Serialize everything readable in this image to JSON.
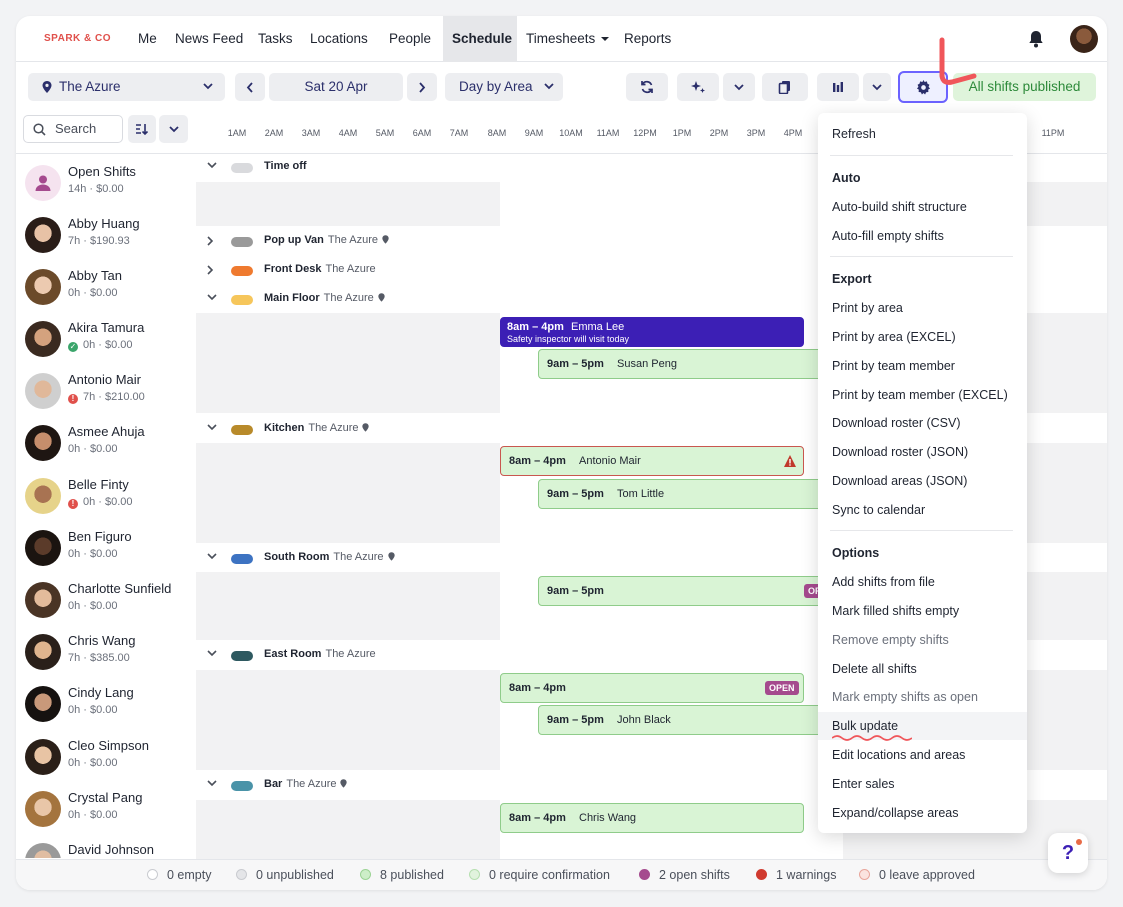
{
  "nav": {
    "brand": "SPARK & CO",
    "items": [
      "Me",
      "News Feed",
      "Tasks",
      "Locations",
      "People",
      "Schedule",
      "Timesheets",
      "Reports"
    ],
    "active": "Schedule"
  },
  "toolbar": {
    "location": "The Azure",
    "date": "Sat 20 Apr",
    "view": "Day by Area",
    "published": "All shifts published"
  },
  "search": {
    "label": "Search"
  },
  "hours": [
    "1AM",
    "2AM",
    "3AM",
    "4AM",
    "5AM",
    "6AM",
    "7AM",
    "8AM",
    "9AM",
    "10AM",
    "11AM",
    "12PM",
    "1PM",
    "2PM",
    "3PM",
    "4PM",
    "11PM"
  ],
  "people": [
    {
      "name": "Open Shifts",
      "meta": "14h · $0.00",
      "status": ""
    },
    {
      "name": "Abby Huang",
      "meta": "7h · $190.93",
      "status": ""
    },
    {
      "name": "Abby Tan",
      "meta": "0h · $0.00",
      "status": ""
    },
    {
      "name": "Akira Tamura",
      "meta": "0h · $0.00",
      "status": "ok"
    },
    {
      "name": "Antonio Mair",
      "meta": "7h · $210.00",
      "status": "warn"
    },
    {
      "name": "Asmee Ahuja",
      "meta": "0h · $0.00",
      "status": ""
    },
    {
      "name": "Belle Finty",
      "meta": "0h · $0.00",
      "status": "warn"
    },
    {
      "name": "Ben Figuro",
      "meta": "0h · $0.00",
      "status": ""
    },
    {
      "name": "Charlotte Sunfield",
      "meta": "0h · $0.00",
      "status": ""
    },
    {
      "name": "Chris Wang",
      "meta": "7h · $385.00",
      "status": ""
    },
    {
      "name": "Cindy Lang",
      "meta": "0h · $0.00",
      "status": ""
    },
    {
      "name": "Cleo Simpson",
      "meta": "0h · $0.00",
      "status": ""
    },
    {
      "name": "Crystal Pang",
      "meta": "0h · $0.00",
      "status": ""
    },
    {
      "name": "David Johnson",
      "meta": "",
      "status": ""
    }
  ],
  "areas": [
    {
      "title": "Time off",
      "loc": "",
      "color": "#d9dadd",
      "pin": false,
      "expanded": true
    },
    {
      "title": "Pop up Van",
      "loc": "The Azure",
      "color": "#9a9a9a",
      "pin": true,
      "expanded": false
    },
    {
      "title": "Front Desk",
      "loc": "The Azure",
      "color": "#ef7a2f",
      "pin": false,
      "expanded": false
    },
    {
      "title": "Main Floor",
      "loc": "The Azure",
      "color": "#f6c65b",
      "pin": true,
      "expanded": true
    },
    {
      "title": "Kitchen",
      "loc": "The Azure",
      "color": "#b88a2a",
      "pin": true,
      "expanded": true
    },
    {
      "title": "South Room",
      "loc": "The Azure",
      "color": "#3d73c2",
      "pin": true,
      "expanded": true
    },
    {
      "title": "East Room",
      "loc": "The Azure",
      "color": "#2e5960",
      "pin": false,
      "expanded": true
    },
    {
      "title": "Bar",
      "loc": "The Azure",
      "color": "#4a93a8",
      "pin": true,
      "expanded": true
    }
  ],
  "shifts": {
    "main_floor_1": {
      "time": "8am – 4pm",
      "who": "Emma Lee",
      "note": "Safety inspector will visit today"
    },
    "main_floor_2": {
      "time": "9am – 5pm",
      "who": "Susan Peng"
    },
    "kitchen_1": {
      "time": "8am – 4pm",
      "who": "Antonio Mair"
    },
    "kitchen_2": {
      "time": "9am – 5pm",
      "who": "Tom Little"
    },
    "south_1": {
      "time": "9am – 5pm",
      "who": "",
      "badge": "OP"
    },
    "east_1": {
      "time": "8am – 4pm",
      "who": "",
      "badge": "OPEN"
    },
    "east_2": {
      "time": "9am – 5pm",
      "who": "John Black"
    },
    "bar_1": {
      "time": "8am – 4pm",
      "who": "Chris Wang"
    }
  },
  "menu": {
    "refresh": "Refresh",
    "auto_head": "Auto",
    "auto_build": "Auto-build shift structure",
    "auto_fill": "Auto-fill empty shifts",
    "export_head": "Export",
    "print_area": "Print by area",
    "print_area_excel": "Print by area (EXCEL)",
    "print_member": "Print by team member",
    "print_member_excel": "Print by team member (EXCEL)",
    "download_csv": "Download roster (CSV)",
    "download_json": "Download roster (JSON)",
    "download_areas": "Download areas (JSON)",
    "sync": "Sync to calendar",
    "options_head": "Options",
    "add_from_file": "Add shifts from file",
    "mark_filled_empty": "Mark filled shifts empty",
    "remove_empty": "Remove empty shifts",
    "delete_all": "Delete all shifts",
    "mark_empty_open": "Mark empty shifts as open",
    "bulk_update": "Bulk update",
    "edit_locations": "Edit locations and areas",
    "enter_sales": "Enter sales",
    "expand_collapse": "Expand/collapse areas"
  },
  "legend": [
    {
      "label": "0 empty",
      "color": "#ffffff"
    },
    {
      "label": "0 unpublished",
      "color": "#e4e5e8"
    },
    {
      "label": "8 published",
      "color": "#cdeec8"
    },
    {
      "label": "0 require confirmation",
      "color": "#e1f3dd"
    },
    {
      "label": "2 open shifts",
      "color": "#a54a8e"
    },
    {
      "label": "1 warnings",
      "color": "#d03a2f"
    },
    {
      "label": "0 leave approved",
      "color": "#fbe3df"
    }
  ],
  "colors": {
    "accent": "#3c1fb5",
    "brand": "#e0504b",
    "published_bg": "#dff4db",
    "gear_border": "#6c63ff"
  },
  "help": {
    "label": "?"
  }
}
